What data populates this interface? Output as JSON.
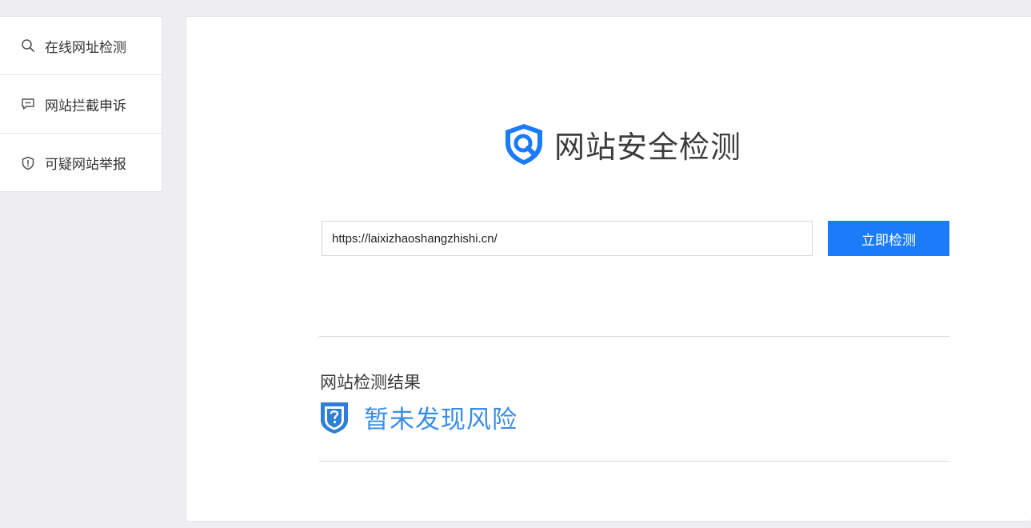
{
  "sidebar": {
    "items": [
      {
        "icon": "search-icon",
        "label": "在线网址检测"
      },
      {
        "icon": "message-icon",
        "label": "网站拦截申诉"
      },
      {
        "icon": "shield-alert-icon",
        "label": "可疑网站举报"
      }
    ]
  },
  "main": {
    "logo_title": "网站安全检测",
    "url_input_value": "https://laixizhaoshangzhishi.cn/",
    "check_button_label": "立即检测",
    "result_heading": "网站检测结果",
    "result_status": "暂未发现风险"
  },
  "colors": {
    "accent": "#1a7bfb",
    "result_text": "#3a8ee6",
    "background": "#eeeef2"
  }
}
